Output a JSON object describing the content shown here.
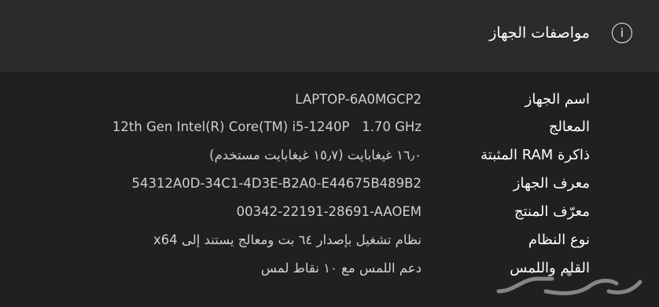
{
  "header": {
    "title": "مواصفات الجهاز",
    "icon": "info-icon"
  },
  "specs": [
    {
      "label": "اسم الجهاز",
      "value": "LAPTOP-6A0MGCP2"
    },
    {
      "label": "المعالج",
      "value": "12th Gen Intel(R) Core(TM) i5-1240P   1.70 GHz"
    },
    {
      "label": "ذاكرة RAM المثبتة",
      "value": "١٦٫٠ غيغابايت (١٥٫٧ غيغابايت مستخدم)"
    },
    {
      "label": "معرف الجهاز",
      "value": "54312A0D-34C1-4D3E-B2A0-E44675B489B2"
    },
    {
      "label": "معرّف المنتج",
      "value": "00342-22191-28691-AAOEM"
    },
    {
      "label": "نوع النظام",
      "value": "نظام تشغيل بإصدار ٦٤ بت ومعالج يستند إلى x64"
    },
    {
      "label": "القلم واللمس",
      "value": "دعم اللمس مع ١٠ نقاط لمس"
    }
  ],
  "colors": {
    "header_bg": "#2b2b2b",
    "body_bg": "#202020",
    "label": "#ffffff",
    "value": "#d0d0d0"
  }
}
